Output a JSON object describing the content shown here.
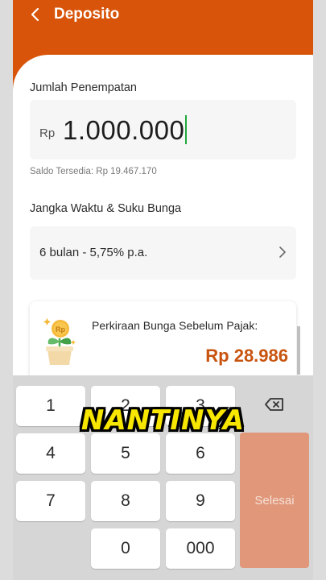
{
  "header": {
    "title": "Deposito"
  },
  "amount": {
    "label": "Jumlah Penempatan",
    "currency": "Rp",
    "value": "1.000.000",
    "saldo": "Saldo Tersedia: Rp 19.467.170"
  },
  "term": {
    "label": "Jangka Waktu & Suku Bunga",
    "value": "6 bulan - 5,75% p.a."
  },
  "interest": {
    "label": "Perkiraan Bunga Sebelum Pajak:",
    "value": "Rp 28.986",
    "coin_text": "Rp"
  },
  "keypad": {
    "keys": [
      "1",
      "2",
      "3",
      "4",
      "5",
      "6",
      "7",
      "8",
      "9",
      "0",
      "000"
    ],
    "done_label": "Selesai"
  },
  "caption": "NANTINYA",
  "colors": {
    "brand": "#d8540a",
    "accent_text": "#c8540f",
    "done_button": "#e0977a",
    "caret": "#21a83b",
    "caption": "#f7e600"
  },
  "icons": [
    "back-arrow-icon",
    "chevron-right-icon",
    "money-plant-icon",
    "backspace-icon"
  ]
}
